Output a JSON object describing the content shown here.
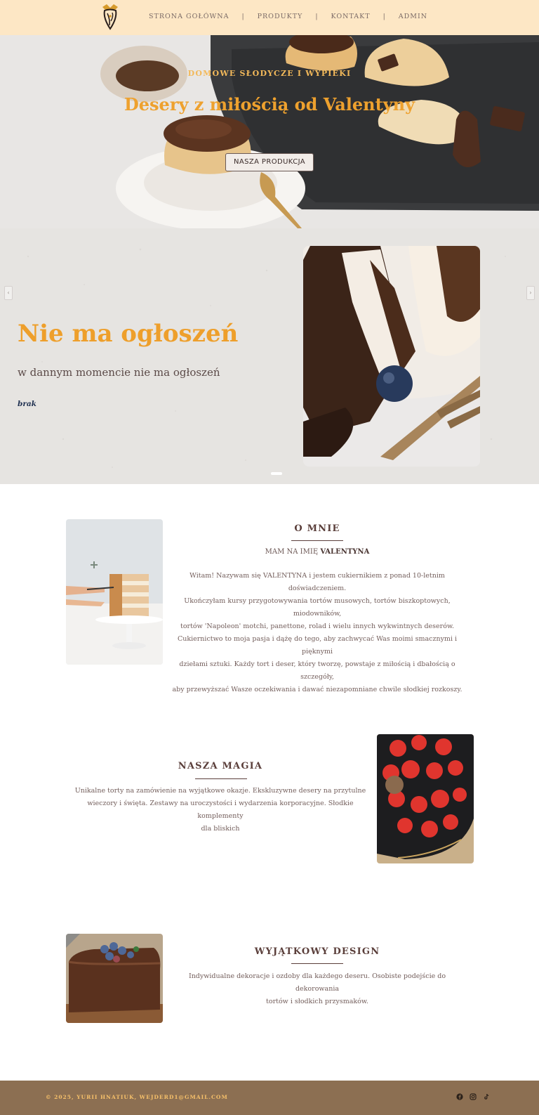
{
  "nav": {
    "logo": "valentyna-logo",
    "links": [
      {
        "label": "STRONA GOŁÓWNA"
      },
      {
        "label": "PRODUKTY"
      },
      {
        "label": "KONTAKT"
      },
      {
        "label": "ADMIN"
      }
    ],
    "separator": "|"
  },
  "hero": {
    "kicker": "DOMOWE SŁODYCZE I WYPIEKI",
    "title": "Desery z miłością od Valentyny",
    "button_label": "NASZA PRODUKCJA"
  },
  "announcement": {
    "title": "Nie ma ogłoszeń",
    "text": "w dannym momencie nie ma ogłoszeń",
    "tag": "brak",
    "prev_icon": "chevron-left-icon",
    "next_icon": "chevron-right-icon"
  },
  "about": {
    "heading": "O MNIE",
    "subtitle_prefix": "MAM NA IMIĘ ",
    "subtitle_name": "VALENTYNA",
    "body_lines": [
      "Witam! Nazywam się VALENTYNA i jestem cukiernikiem z ponad 10-letnim doświadczeniem.",
      "Ukończyłam kursy przygotowywania tortów musowych, tortów biszkoptowych, miodowników,",
      "tortów 'Napoleon' motchi, panettone, rolad i wielu innych wykwintnych deserów.",
      "Cukiernictwo to moja pasja i dążę do tego, aby zachwycać Was moimi smacznymi i pięknymi",
      "dziełami sztuki. Każdy tort i deser, który tworzę, powstaje z miłością i dbałością o szczegóły,",
      "aby przewyższać Wasze oczekiwania i dawać niezapomniane chwile słodkiej rozkoszy."
    ]
  },
  "magic": {
    "heading": "NASZA MAGIA",
    "body_lines": [
      "Unikalne torty na zamówienie na wyjątkowe okazje. Ekskluzywne desery na przytulne",
      "wieczory i święta. Zestawy na uroczystości i wydarzenia korporacyjne. Słodkie komplementy",
      "dla bliskich"
    ]
  },
  "design": {
    "heading": "WYJĄTKOWY DESIGN",
    "body_lines": [
      "Indywidualne dekoracje i ozdoby dla każdego deseru. Osobiste podejście do dekorowania",
      "tortów i słodkich przysmaków."
    ]
  },
  "footer": {
    "text": "© 2025, YURII HNATIUK, WEJDERD1@GMAIL.COM",
    "social_icons": [
      "facebook-icon",
      "instagram-icon",
      "tiktok-icon"
    ]
  },
  "colors": {
    "nav_bg": "#fde7c5",
    "accent_orange": "#ee9f2b",
    "heading_brown": "#5a3e3a",
    "footer_bg": "#8c6f52",
    "footer_text": "#f6c06a"
  }
}
